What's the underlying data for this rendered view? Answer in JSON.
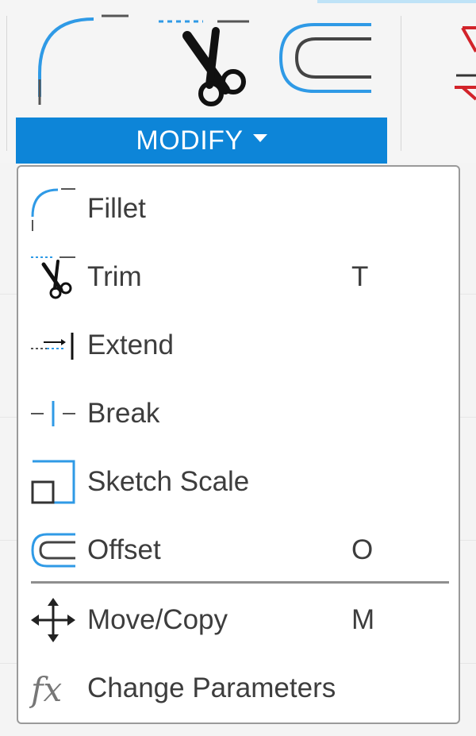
{
  "toolbar": {
    "panel_label": "MODIFY",
    "tools": [
      "fillet-tool-icon",
      "trim-tool-icon",
      "offset-tool-icon",
      "next-panel-icon"
    ]
  },
  "menu": {
    "items": [
      {
        "label": "Fillet",
        "shortcut": "",
        "icon": "fillet-icon"
      },
      {
        "label": "Trim",
        "shortcut": "T",
        "icon": "trim-icon"
      },
      {
        "label": "Extend",
        "shortcut": "",
        "icon": "extend-icon"
      },
      {
        "label": "Break",
        "shortcut": "",
        "icon": "break-icon"
      },
      {
        "label": "Sketch Scale",
        "shortcut": "",
        "icon": "sketch-scale-icon"
      },
      {
        "label": "Offset",
        "shortcut": "O",
        "icon": "offset-icon"
      },
      {
        "label": "Move/Copy",
        "shortcut": "M",
        "icon": "move-copy-icon"
      },
      {
        "label": "Change Parameters",
        "shortcut": "",
        "icon": "change-parameters-icon"
      }
    ]
  },
  "colors": {
    "accent": "#0d85d8",
    "icon_blue": "#2f9ae6",
    "text": "#3d3d3d",
    "red_icon": "#d2232a"
  }
}
